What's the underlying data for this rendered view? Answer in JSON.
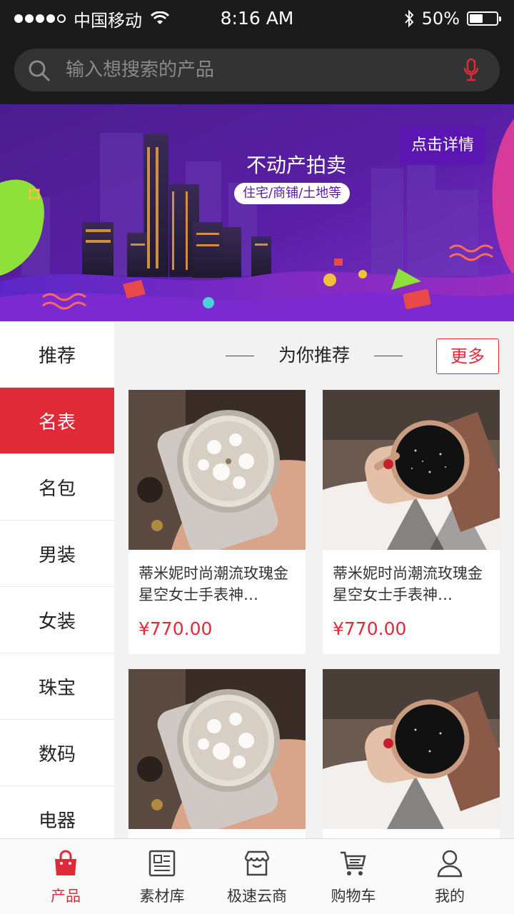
{
  "status_bar": {
    "carrier": "中国移动",
    "time": "8:16 AM",
    "battery": "50%",
    "battery_level": 0.5,
    "icons": [
      "signal-dots",
      "wifi-icon",
      "bluetooth-icon",
      "battery-icon"
    ]
  },
  "search": {
    "placeholder": "输入想搜索的产品",
    "icons": [
      "search-icon",
      "mic-icon"
    ]
  },
  "banner": {
    "title": "不动产拍卖",
    "tag": "住宅/商铺/土地等",
    "button": "点击详情"
  },
  "sidebar": {
    "items": [
      {
        "label": "推荐"
      },
      {
        "label": "名表"
      },
      {
        "label": "名包"
      },
      {
        "label": "男装"
      },
      {
        "label": "女装"
      },
      {
        "label": "珠宝"
      },
      {
        "label": "数码"
      },
      {
        "label": "电器"
      }
    ],
    "active": "名表"
  },
  "section": {
    "title": "为你推荐",
    "more": "更多"
  },
  "products": [
    {
      "title": "蒂米妮时尚潮流玫瑰金星空女士手表神…",
      "price": "¥770.00",
      "image": "crystal-watch-photo"
    },
    {
      "title": "蒂米妮时尚潮流玫瑰金星空女士手表神…",
      "price": "¥770.00",
      "image": "starry-watch-photo"
    },
    {
      "title": "",
      "price": "",
      "image": "crystal-watch-photo"
    },
    {
      "title": "",
      "price": "",
      "image": "starry-watch-photo"
    }
  ],
  "tabbar": {
    "tabs": [
      {
        "label": "产品",
        "icon": "bag-icon"
      },
      {
        "label": "素材库",
        "icon": "newspaper-icon"
      },
      {
        "label": "极速云商",
        "icon": "store-icon"
      },
      {
        "label": "购物车",
        "icon": "cart-icon"
      },
      {
        "label": "我的",
        "icon": "user-icon"
      }
    ],
    "active": "产品"
  },
  "colors": {
    "accent": "#e02a37",
    "header_bg": "#1b1b1b",
    "banner_purple": "#5b15b0"
  }
}
